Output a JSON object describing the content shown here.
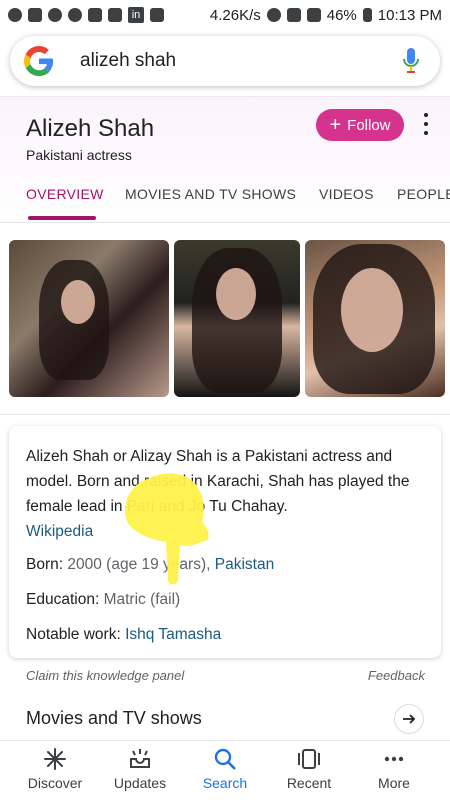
{
  "status_bar": {
    "network_speed": "4.26K/s",
    "battery": "46%",
    "time": "10:13 PM",
    "app_badge": "in"
  },
  "search": {
    "query": "alizeh shah"
  },
  "knowledge_panel": {
    "title": "Alizeh Shah",
    "subtitle": "Pakistani actress",
    "follow_label": "Follow",
    "tabs": [
      {
        "label": "OVERVIEW"
      },
      {
        "label": "MOVIES AND TV SHOWS"
      },
      {
        "label": "VIDEOS"
      },
      {
        "label": "PEOPLE"
      }
    ],
    "description": "Alizeh Shah or Alizay Shah is a Pakistani actress and model. Born and raised in Karachi, Shah has played the female lead in Pari and Jo Tu Chahay.",
    "source_link": "Wikipedia",
    "facts": {
      "born_label": "Born:",
      "born_value": "2000 (age 19 years),",
      "born_place": "Pakistan",
      "education_label": "Education:",
      "education_value": "Matric (fail)",
      "notable_label": "Notable work:",
      "notable_value": "Ishq Tamasha"
    },
    "claim_text": "Claim this knowledge panel",
    "feedback_text": "Feedback",
    "movies_heading": "Movies and TV shows"
  },
  "bottom_nav": [
    {
      "label": "Discover"
    },
    {
      "label": "Updates"
    },
    {
      "label": "Search"
    },
    {
      "label": "Recent"
    },
    {
      "label": "More"
    }
  ],
  "colors": {
    "accent_pink": "#d6338f",
    "tab_active": "#a0146d",
    "link_blue": "#1a5a80",
    "nav_active": "#1a73e8"
  }
}
